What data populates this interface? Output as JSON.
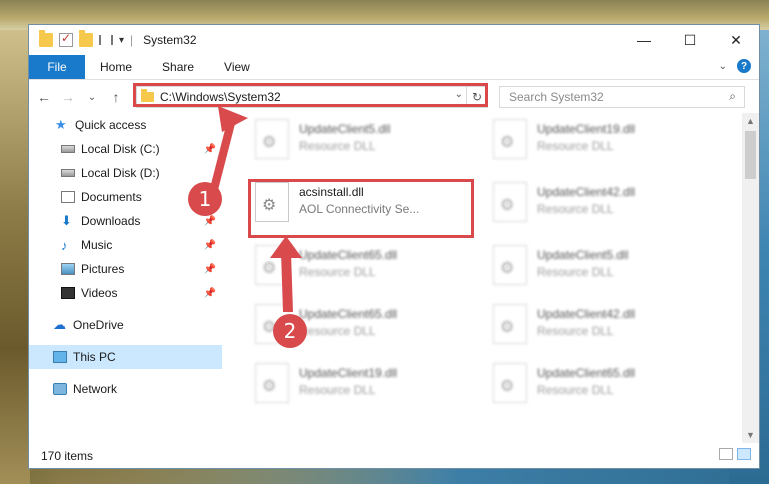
{
  "window": {
    "title": "System32"
  },
  "window_controls": {
    "minimize": "—",
    "maximize": "☐",
    "close": "✕"
  },
  "ribbon": {
    "file": "File",
    "home": "Home",
    "share": "Share",
    "view": "View"
  },
  "nav": {
    "back": "←",
    "forward": "→",
    "recent": "⌄",
    "up": "↑"
  },
  "address": {
    "path": "C:\\Windows\\System32",
    "dropdown": "⌄",
    "refresh": "↻"
  },
  "search": {
    "placeholder": "Search System32"
  },
  "sidebar": {
    "items": [
      {
        "label": "Quick access"
      },
      {
        "label": "Local Disk (C:)"
      },
      {
        "label": "Local Disk (D:)"
      },
      {
        "label": "Documents"
      },
      {
        "label": "Downloads"
      },
      {
        "label": "Music"
      },
      {
        "label": "Pictures"
      },
      {
        "label": "Videos"
      },
      {
        "label": "OneDrive"
      },
      {
        "label": "This PC"
      },
      {
        "label": "Network"
      }
    ]
  },
  "files": {
    "highlighted": {
      "name": "acsinstall.dll",
      "type": "AOL Connectivity Se..."
    },
    "left": [
      {
        "name": "UpdateClient5.dll",
        "type": "Resource DLL"
      },
      {
        "name": "UpdateClient65.dll",
        "type": "Resource DLL"
      },
      {
        "name": "UpdateClient65.dll",
        "type": "Resource DLL"
      },
      {
        "name": "UpdateClient19.dll",
        "type": "Resource DLL"
      }
    ],
    "right": [
      {
        "name": "UpdateClient19.dll",
        "type": "Resource DLL"
      },
      {
        "name": "UpdateClient42.dll",
        "type": "Resource DLL"
      },
      {
        "name": "UpdateClient5.dll",
        "type": "Resource DLL"
      },
      {
        "name": "UpdateClient42.dll",
        "type": "Resource DLL"
      },
      {
        "name": "UpdateClient65.dll",
        "type": "Resource DLL"
      }
    ]
  },
  "status": {
    "count": "170 items"
  },
  "callouts": {
    "one": "1",
    "two": "2"
  },
  "colors": {
    "accent": "#1979ca",
    "highlight": "#d9484b",
    "selection": "#cce8ff"
  }
}
